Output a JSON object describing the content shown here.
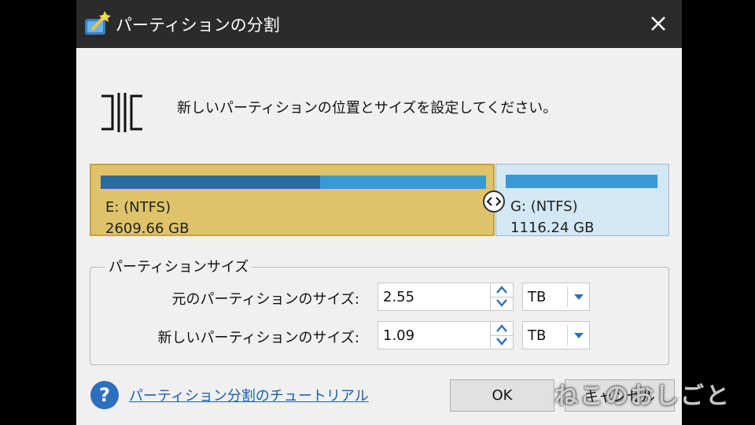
{
  "window": {
    "title": "パーティションの分割",
    "app_icon": "partition-wizard-icon",
    "close_icon": "close-icon"
  },
  "instruction": "新しいパーティションの位置とサイズを設定してください。",
  "partitions": [
    {
      "name": "E: (NTFS)",
      "size": "2609.66 GB",
      "used_fraction": 0.57,
      "color": "#dfc36a"
    },
    {
      "name": "G: (NTFS)",
      "size": "1116.24 GB",
      "color": "#d3e8f5"
    }
  ],
  "size_group": {
    "title": "パーティションサイズ",
    "original": {
      "label": "元のパーティションのサイズ:",
      "value": "2.55",
      "unit": "TB"
    },
    "new": {
      "label": "新しいパーティションのサイズ:",
      "value": "1.09",
      "unit": "TB"
    }
  },
  "footer": {
    "help_icon": "question-icon",
    "help_glyph": "?",
    "tutorial_link": "パーティション分割のチュートリアル",
    "ok_label": "OK",
    "cancel_label": "キャンセル"
  },
  "watermark": "ねこのおしごと",
  "colors": {
    "titlebar": "#2b2b2b",
    "bar_used": "#2b6b9e",
    "bar_free": "#3a98d6",
    "link": "#1a5fb4"
  }
}
